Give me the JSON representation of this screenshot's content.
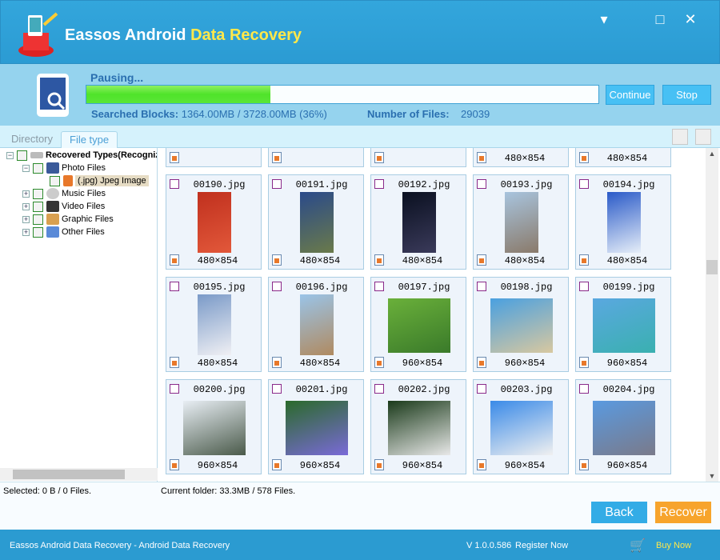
{
  "window": {
    "title_main": "Eassos Android ",
    "title_highlight": "Data Recovery",
    "minimize": "▾",
    "maximize": "□",
    "close": "✕"
  },
  "progress": {
    "status": "Pausing...",
    "percent": 36,
    "searched_label": "Searched Blocks:",
    "searched_value": "1364.00MB / 3728.00MB (36%)",
    "files_label": "Number of Files:",
    "files_value": "29039",
    "continue": "Continue",
    "stop": "Stop"
  },
  "tabs": [
    {
      "label": "Directory"
    },
    {
      "label": "File type"
    }
  ],
  "tree": {
    "root": "Recovered Types(Recognized)",
    "photo": "Photo Files",
    "jpeg": "(.jpg) Jpeg Image",
    "music": "Music Files",
    "video": "Video Files",
    "graphic": "Graphic Files",
    "other": "Other Files"
  },
  "grid": {
    "partial_row": [
      {
        "dim": ""
      },
      {
        "dim": ""
      },
      {
        "dim": ""
      },
      {
        "dim": "480×854"
      },
      {
        "dim": "480×854"
      }
    ],
    "rows": [
      [
        {
          "name": "00190.jpg",
          "dim": "480×854",
          "colors": [
            "#c0301e",
            "#e2583a"
          ]
        },
        {
          "name": "00191.jpg",
          "dim": "480×854",
          "colors": [
            "#2a4a8a",
            "#6a7a4a"
          ]
        },
        {
          "name": "00192.jpg",
          "dim": "480×854",
          "colors": [
            "#0a1020",
            "#3a3a5a"
          ]
        },
        {
          "name": "00193.jpg",
          "dim": "480×854",
          "colors": [
            "#a8c4de",
            "#8a7a6a"
          ]
        },
        {
          "name": "00194.jpg",
          "dim": "480×854",
          "colors": [
            "#2a5ac8",
            "#e6eef8"
          ]
        }
      ],
      [
        {
          "name": "00195.jpg",
          "dim": "480×854",
          "colors": [
            "#7a9ac8",
            "#f0f0f4"
          ]
        },
        {
          "name": "00196.jpg",
          "dim": "480×854",
          "colors": [
            "#9ac4e8",
            "#b08a60"
          ]
        },
        {
          "name": "00197.jpg",
          "dim": "960×854",
          "colors": [
            "#6ab03a",
            "#3a7a2a"
          ]
        },
        {
          "name": "00198.jpg",
          "dim": "960×854",
          "colors": [
            "#4aa0e0",
            "#d8c8a0"
          ]
        },
        {
          "name": "00199.jpg",
          "dim": "960×854",
          "colors": [
            "#5aa8e0",
            "#3ab0b0"
          ]
        }
      ],
      [
        {
          "name": "00200.jpg",
          "dim": "960×854",
          "colors": [
            "#e8eef4",
            "#4a5a4a"
          ]
        },
        {
          "name": "00201.jpg",
          "dim": "960×854",
          "colors": [
            "#2a6a2a",
            "#7a6ad8"
          ]
        },
        {
          "name": "00202.jpg",
          "dim": "960×854",
          "colors": [
            "#1a3a1a",
            "#e8e8e8"
          ]
        },
        {
          "name": "00203.jpg",
          "dim": "960×854",
          "colors": [
            "#3a8ae8",
            "#f0f0f0"
          ]
        },
        {
          "name": "00204.jpg",
          "dim": "960×854",
          "colors": [
            "#5a9ae0",
            "#7a7a8a"
          ]
        }
      ]
    ]
  },
  "status": {
    "selected": "Selected: 0 B / 0 Files.",
    "current_folder": "Current folder: 33.3MB / 578 Files."
  },
  "actions": {
    "back": "Back",
    "recover": "Recover"
  },
  "footer": {
    "app": "Eassos Android Data Recovery - Android Data Recovery",
    "version": "V 1.0.0.586",
    "register": "Register Now",
    "buy": "Buy Now"
  },
  "colors": {
    "titlebar": "#2b9bd3",
    "panel": "#95d3ee",
    "progress": "#4fe32a",
    "button": "#47c0f4",
    "recover": "#f7a42c",
    "buy": "#ffe84a"
  }
}
